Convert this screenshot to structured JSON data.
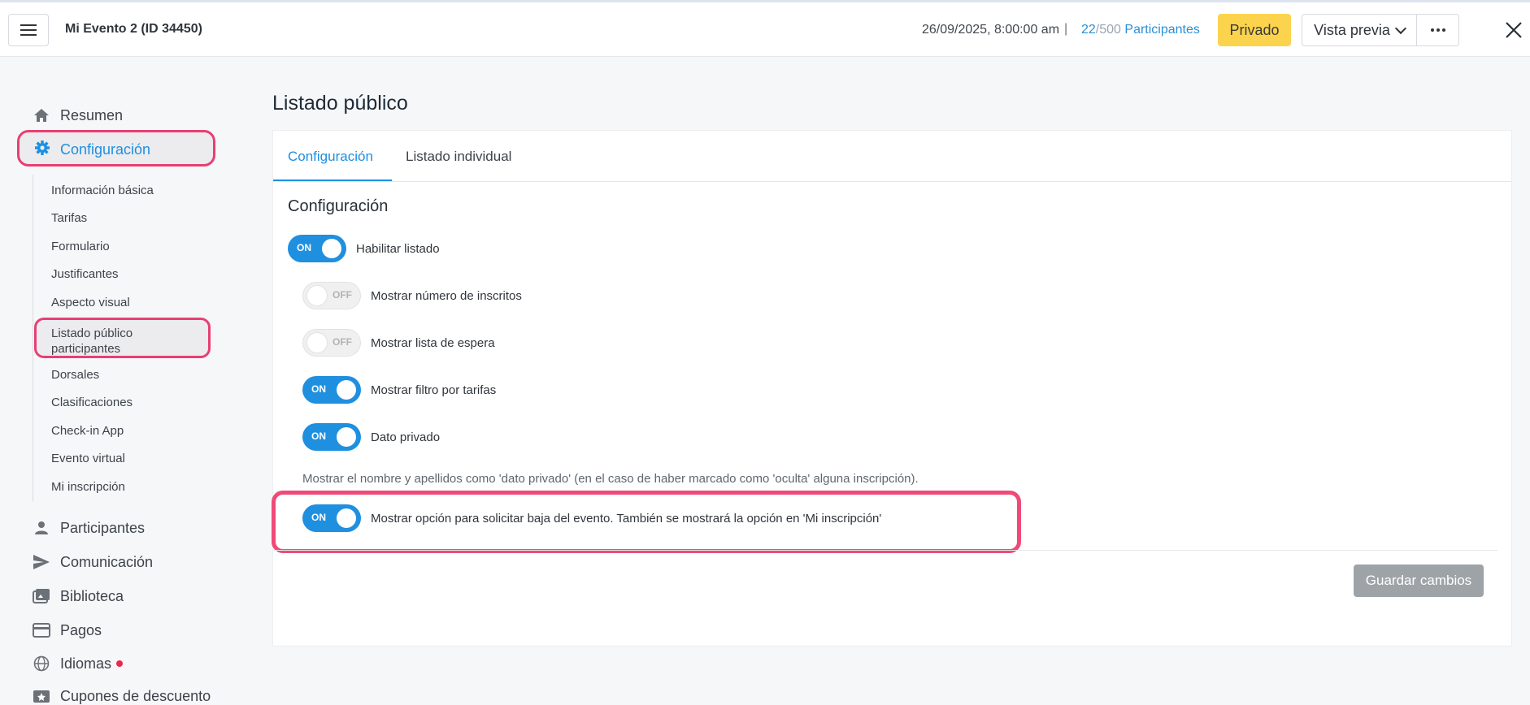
{
  "header": {
    "event_title": "Mi Evento 2 (ID 34450)",
    "datetime": "26/09/2025, 8:00:00 am",
    "separator": "|",
    "participants_current": "22",
    "participants_total": "/500",
    "participants_label": "Participantes",
    "private_label": "Privado",
    "preview_label": "Vista previa"
  },
  "sidebar": {
    "items_top": [
      {
        "label": "Resumen",
        "icon": "home-icon"
      },
      {
        "label": "Configuración",
        "icon": "gear-icon"
      }
    ],
    "sub_items": [
      "Información básica",
      "Tarifas",
      "Formulario",
      "Justificantes",
      "Aspecto visual",
      "Listado público participantes",
      "Dorsales",
      "Clasificaciones",
      "Check-in App",
      "Evento virtual",
      "Mi inscripción"
    ],
    "items_bottom": [
      {
        "label": "Participantes",
        "icon": "person-icon"
      },
      {
        "label": "Comunicación",
        "icon": "send-icon"
      },
      {
        "label": "Biblioteca",
        "icon": "images-icon"
      },
      {
        "label": "Pagos",
        "icon": "card-icon"
      },
      {
        "label": "Idiomas",
        "icon": "globe-icon"
      },
      {
        "label": "Cupones de descuento",
        "icon": "coupon-icon"
      }
    ]
  },
  "main": {
    "page_title": "Listado público",
    "tabs": [
      "Configuración",
      "Listado individual"
    ],
    "section_title": "Configuración",
    "toggles": [
      {
        "label": "Habilitar listado",
        "state": "ON"
      },
      {
        "label": "Mostrar número de inscritos",
        "state": "OFF"
      },
      {
        "label": "Mostrar lista de espera",
        "state": "OFF"
      },
      {
        "label": "Mostrar filtro por tarifas",
        "state": "ON"
      },
      {
        "label": "Dato privado",
        "state": "ON"
      },
      {
        "label": "Mostrar opción para solicitar baja del evento. También se mostrará la opción en 'Mi inscripción'",
        "state": "ON"
      }
    ],
    "private_note": "Mostrar el nombre y apellidos como 'dato privado' (en el caso de haber marcado como 'oculta' alguna inscripción).",
    "save_label": "Guardar cambios"
  },
  "colors": {
    "accent": "#1f8fe0",
    "highlight": "#e83f73",
    "private_btn": "#fcd34d",
    "save_btn": "#9ea3a8"
  }
}
